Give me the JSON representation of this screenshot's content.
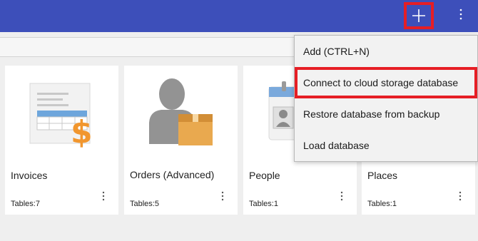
{
  "topbar": {
    "accent_color": "#3d4fba",
    "add_icon": "plus-icon",
    "more_icon": "more-vertical-icon"
  },
  "cards": [
    {
      "title": "Invoices",
      "tables": "Tables:7",
      "icon": "invoice-icon"
    },
    {
      "title": "Orders (Advanced)",
      "tables": "Tables:5",
      "icon": "person-box-icon"
    },
    {
      "title": "People",
      "tables": "Tables:1",
      "icon": "contact-card-icon"
    },
    {
      "title": "Places",
      "tables": "Tables:1",
      "icon": "place-icon"
    }
  ],
  "menu": {
    "items": [
      {
        "label": "Add (CTRL+N)"
      },
      {
        "label": "Connect to cloud storage database"
      },
      {
        "label": "Restore database from backup"
      },
      {
        "label": "Load database"
      }
    ]
  },
  "highlight_color": "#e61e25"
}
